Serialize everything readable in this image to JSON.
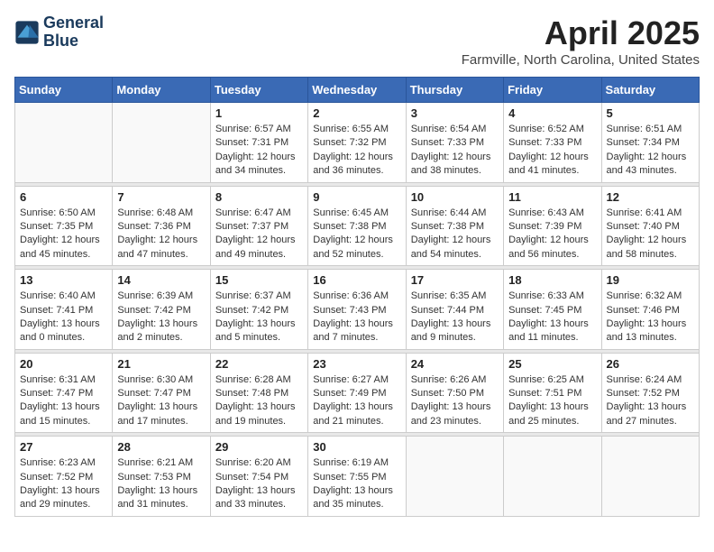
{
  "header": {
    "logo_line1": "General",
    "logo_line2": "Blue",
    "month": "April 2025",
    "location": "Farmville, North Carolina, United States"
  },
  "days_of_week": [
    "Sunday",
    "Monday",
    "Tuesday",
    "Wednesday",
    "Thursday",
    "Friday",
    "Saturday"
  ],
  "weeks": [
    [
      {
        "day": "",
        "sunrise": "",
        "sunset": "",
        "daylight": ""
      },
      {
        "day": "",
        "sunrise": "",
        "sunset": "",
        "daylight": ""
      },
      {
        "day": "1",
        "sunrise": "Sunrise: 6:57 AM",
        "sunset": "Sunset: 7:31 PM",
        "daylight": "Daylight: 12 hours and 34 minutes."
      },
      {
        "day": "2",
        "sunrise": "Sunrise: 6:55 AM",
        "sunset": "Sunset: 7:32 PM",
        "daylight": "Daylight: 12 hours and 36 minutes."
      },
      {
        "day": "3",
        "sunrise": "Sunrise: 6:54 AM",
        "sunset": "Sunset: 7:33 PM",
        "daylight": "Daylight: 12 hours and 38 minutes."
      },
      {
        "day": "4",
        "sunrise": "Sunrise: 6:52 AM",
        "sunset": "Sunset: 7:33 PM",
        "daylight": "Daylight: 12 hours and 41 minutes."
      },
      {
        "day": "5",
        "sunrise": "Sunrise: 6:51 AM",
        "sunset": "Sunset: 7:34 PM",
        "daylight": "Daylight: 12 hours and 43 minutes."
      }
    ],
    [
      {
        "day": "6",
        "sunrise": "Sunrise: 6:50 AM",
        "sunset": "Sunset: 7:35 PM",
        "daylight": "Daylight: 12 hours and 45 minutes."
      },
      {
        "day": "7",
        "sunrise": "Sunrise: 6:48 AM",
        "sunset": "Sunset: 7:36 PM",
        "daylight": "Daylight: 12 hours and 47 minutes."
      },
      {
        "day": "8",
        "sunrise": "Sunrise: 6:47 AM",
        "sunset": "Sunset: 7:37 PM",
        "daylight": "Daylight: 12 hours and 49 minutes."
      },
      {
        "day": "9",
        "sunrise": "Sunrise: 6:45 AM",
        "sunset": "Sunset: 7:38 PM",
        "daylight": "Daylight: 12 hours and 52 minutes."
      },
      {
        "day": "10",
        "sunrise": "Sunrise: 6:44 AM",
        "sunset": "Sunset: 7:38 PM",
        "daylight": "Daylight: 12 hours and 54 minutes."
      },
      {
        "day": "11",
        "sunrise": "Sunrise: 6:43 AM",
        "sunset": "Sunset: 7:39 PM",
        "daylight": "Daylight: 12 hours and 56 minutes."
      },
      {
        "day": "12",
        "sunrise": "Sunrise: 6:41 AM",
        "sunset": "Sunset: 7:40 PM",
        "daylight": "Daylight: 12 hours and 58 minutes."
      }
    ],
    [
      {
        "day": "13",
        "sunrise": "Sunrise: 6:40 AM",
        "sunset": "Sunset: 7:41 PM",
        "daylight": "Daylight: 13 hours and 0 minutes."
      },
      {
        "day": "14",
        "sunrise": "Sunrise: 6:39 AM",
        "sunset": "Sunset: 7:42 PM",
        "daylight": "Daylight: 13 hours and 2 minutes."
      },
      {
        "day": "15",
        "sunrise": "Sunrise: 6:37 AM",
        "sunset": "Sunset: 7:42 PM",
        "daylight": "Daylight: 13 hours and 5 minutes."
      },
      {
        "day": "16",
        "sunrise": "Sunrise: 6:36 AM",
        "sunset": "Sunset: 7:43 PM",
        "daylight": "Daylight: 13 hours and 7 minutes."
      },
      {
        "day": "17",
        "sunrise": "Sunrise: 6:35 AM",
        "sunset": "Sunset: 7:44 PM",
        "daylight": "Daylight: 13 hours and 9 minutes."
      },
      {
        "day": "18",
        "sunrise": "Sunrise: 6:33 AM",
        "sunset": "Sunset: 7:45 PM",
        "daylight": "Daylight: 13 hours and 11 minutes."
      },
      {
        "day": "19",
        "sunrise": "Sunrise: 6:32 AM",
        "sunset": "Sunset: 7:46 PM",
        "daylight": "Daylight: 13 hours and 13 minutes."
      }
    ],
    [
      {
        "day": "20",
        "sunrise": "Sunrise: 6:31 AM",
        "sunset": "Sunset: 7:47 PM",
        "daylight": "Daylight: 13 hours and 15 minutes."
      },
      {
        "day": "21",
        "sunrise": "Sunrise: 6:30 AM",
        "sunset": "Sunset: 7:47 PM",
        "daylight": "Daylight: 13 hours and 17 minutes."
      },
      {
        "day": "22",
        "sunrise": "Sunrise: 6:28 AM",
        "sunset": "Sunset: 7:48 PM",
        "daylight": "Daylight: 13 hours and 19 minutes."
      },
      {
        "day": "23",
        "sunrise": "Sunrise: 6:27 AM",
        "sunset": "Sunset: 7:49 PM",
        "daylight": "Daylight: 13 hours and 21 minutes."
      },
      {
        "day": "24",
        "sunrise": "Sunrise: 6:26 AM",
        "sunset": "Sunset: 7:50 PM",
        "daylight": "Daylight: 13 hours and 23 minutes."
      },
      {
        "day": "25",
        "sunrise": "Sunrise: 6:25 AM",
        "sunset": "Sunset: 7:51 PM",
        "daylight": "Daylight: 13 hours and 25 minutes."
      },
      {
        "day": "26",
        "sunrise": "Sunrise: 6:24 AM",
        "sunset": "Sunset: 7:52 PM",
        "daylight": "Daylight: 13 hours and 27 minutes."
      }
    ],
    [
      {
        "day": "27",
        "sunrise": "Sunrise: 6:23 AM",
        "sunset": "Sunset: 7:52 PM",
        "daylight": "Daylight: 13 hours and 29 minutes."
      },
      {
        "day": "28",
        "sunrise": "Sunrise: 6:21 AM",
        "sunset": "Sunset: 7:53 PM",
        "daylight": "Daylight: 13 hours and 31 minutes."
      },
      {
        "day": "29",
        "sunrise": "Sunrise: 6:20 AM",
        "sunset": "Sunset: 7:54 PM",
        "daylight": "Daylight: 13 hours and 33 minutes."
      },
      {
        "day": "30",
        "sunrise": "Sunrise: 6:19 AM",
        "sunset": "Sunset: 7:55 PM",
        "daylight": "Daylight: 13 hours and 35 minutes."
      },
      {
        "day": "",
        "sunrise": "",
        "sunset": "",
        "daylight": ""
      },
      {
        "day": "",
        "sunrise": "",
        "sunset": "",
        "daylight": ""
      },
      {
        "day": "",
        "sunrise": "",
        "sunset": "",
        "daylight": ""
      }
    ]
  ]
}
